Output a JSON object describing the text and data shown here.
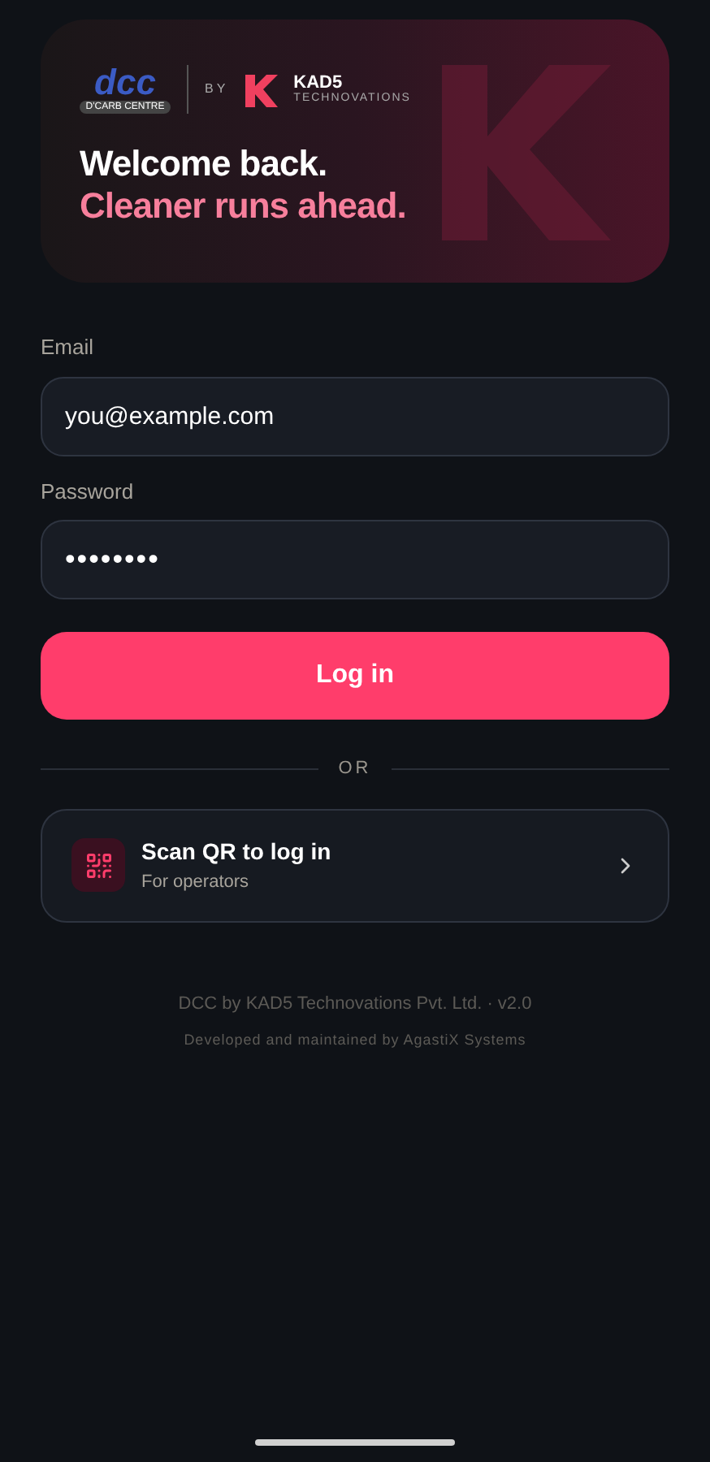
{
  "hero": {
    "logo_text": "dcc",
    "logo_caption": "D'CARB CENTRE",
    "by": "BY",
    "brand": "KAD5",
    "brand_sub": "TECHNOVATIONS",
    "title": "Welcome back.",
    "subtitle": "Cleaner runs ahead."
  },
  "form": {
    "fields": [
      {
        "label": "Email",
        "value": "you@example.com"
      },
      {
        "label": "Password",
        "value": "••••••••"
      }
    ],
    "submit": "Log in"
  },
  "divider": "OR",
  "qr": {
    "title": "Scan QR to log in",
    "subtitle": "For operators"
  },
  "footer": [
    "DCC by KAD5 Technovations Pvt. Ltd. · v2.0",
    "Developed and maintained by AgastiX Systems"
  ]
}
